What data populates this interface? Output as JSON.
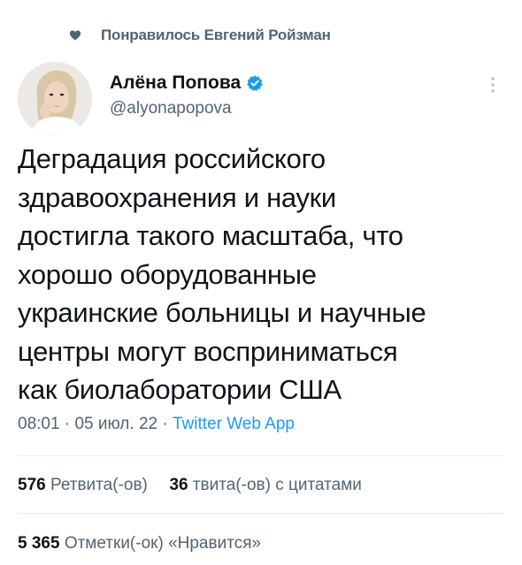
{
  "liked_by": {
    "text": "Понравилось Евгений Ройзман",
    "icon": "heart-icon"
  },
  "author": {
    "name": "Алёна Попова",
    "handle": "@alyonapopova",
    "verified": true,
    "verified_color": "#1d9bf0"
  },
  "tweet": {
    "text": "Деградация российского\nздравоохранения и науки\nдостигла такого масштаба, что\nхорошо оборудованные\nукраинские больницы и научные\nцентры могут восприниматься\nкак биолаборатории США"
  },
  "meta": {
    "time": "08:01",
    "sep1": " · ",
    "date": "05 июл. 22",
    "sep2": " · ",
    "source": "Twitter Web App"
  },
  "stats": {
    "retweets_count": "576",
    "retweets_label": "Ретвита(-ов)",
    "quotes_count": "36",
    "quotes_label": "твита(-ов) с цитатами",
    "likes_count": "5 365",
    "likes_label": "Отметки(-ок) «Нравится»"
  },
  "colors": {
    "text_primary": "#0f1419",
    "text_secondary": "#536471",
    "accent": "#1d9bf0",
    "divider": "#e6ecf0"
  }
}
